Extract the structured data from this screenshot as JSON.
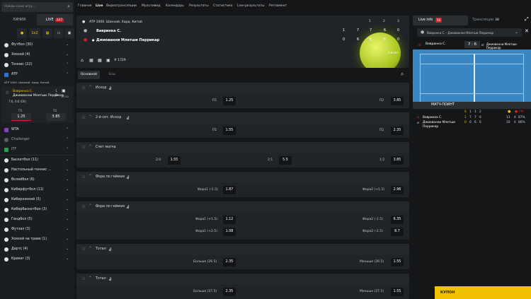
{
  "search": {
    "placeholder": "Найди свою игру..."
  },
  "mode_tabs": {
    "line": "ЛИНИЯ",
    "live": "LIVE",
    "live_count": "127"
  },
  "quick_icons": [
    "1x2"
  ],
  "sidebar": {
    "sports": [
      {
        "label": "Футбол (30)"
      },
      {
        "label": "Хоккей (4)"
      },
      {
        "label": "Теннис (22)"
      },
      {
        "label": "ATP"
      }
    ],
    "match": {
      "tour": "ATP 1000. Шанхай. Хард. Китай",
      "p1": "Вавринка С.",
      "p2": "Джиованни Млетши Перрикар",
      "s1": "1",
      "s2": "0",
      "score": "7:6, 6:6 (00)",
      "time": "15:10",
      "o1_label": "П1",
      "o2_label": "П2",
      "o1": "1.25",
      "o2": "3.85"
    },
    "more": [
      {
        "label": "WTA"
      },
      {
        "label": "Challenger"
      },
      {
        "label": "ITF"
      },
      {
        "label": "Баскетбол (11)"
      },
      {
        "label": "Настольный теннис ..."
      },
      {
        "label": "Волейбол (6)"
      },
      {
        "label": "Киберфутбол (11)"
      },
      {
        "label": "Киберхоккей (5)"
      },
      {
        "label": "Кибербаскетбол (3)"
      },
      {
        "label": "Гандбол (5)"
      },
      {
        "label": "Футзал (3)"
      },
      {
        "label": "Хоккей на траве (1)"
      },
      {
        "label": "Дартс (4)"
      },
      {
        "label": "Крикет (3)"
      }
    ]
  },
  "topnav": [
    "Главная",
    "Live",
    "Видеотрансляции",
    "Мультивид",
    "Календарь",
    "Результаты",
    "Статистика",
    "Live-результаты",
    "Регламент"
  ],
  "header": {
    "tour": "ATP 1000. Шанхай. Хард. Китай",
    "cols": [
      "1",
      "2",
      "3"
    ],
    "p1": "Вавринка С.",
    "p2": "Джиованни Млетши Перрикар",
    "p1_scores": [
      "1",
      "7",
      "7",
      "6",
      "0"
    ],
    "p2_scores": [
      "0",
      "6",
      "6",
      "6",
      "0"
    ],
    "set": "2-й сет",
    "event_id": "# 1729"
  },
  "tabs": {
    "main": "Основной",
    "stats": "Бзы"
  },
  "markets": [
    {
      "title": "Исход",
      "rows": [
        [
          {
            "l": "П1",
            "o": "1.25"
          },
          {
            "l": "П2",
            "o": "3.85"
          }
        ]
      ]
    },
    {
      "title": "2-й сет. Исход",
      "rows": [
        [
          {
            "l": "П1",
            "o": "1.55"
          },
          {
            "l": "П2",
            "o": "2.35"
          }
        ]
      ]
    },
    {
      "title": "Счет матча",
      "rows": [
        [
          {
            "l": "2:0",
            "o": "1.55"
          },
          {
            "l": "2:1",
            "o": "5.5"
          },
          {
            "l": "1:2",
            "o": "3.85"
          }
        ]
      ]
    },
    {
      "title": "Фора по геймам",
      "rows": [
        [
          {
            "l": "Фора1 (-1.5)",
            "o": "1.87"
          },
          {
            "l": "Фора2 (+1.5)",
            "o": "2.96"
          }
        ]
      ]
    },
    {
      "title": "Фора по геймам",
      "rows": [
        [
          {
            "l": "Фора1 (+1.5)",
            "o": "1.12"
          },
          {
            "l": "Фора2 (-1.5)",
            "o": "6.35"
          }
        ],
        [
          {
            "l": "Фора1 (+2.5)",
            "o": "1.08"
          },
          {
            "l": "Фора2 (-2.5)",
            "o": "8.7"
          }
        ]
      ]
    },
    {
      "title": "Тотал",
      "rows": [
        [
          {
            "l": "Больше (26.5)",
            "o": "2.35"
          },
          {
            "l": "Меньше (26.5)",
            "o": "1.55"
          }
        ]
      ]
    },
    {
      "title": "Тотал",
      "rows": [
        [
          {
            "l": "Больше (27.5)",
            "o": "2.35"
          },
          {
            "l": "Меньше (27.5)",
            "o": "1.55"
          }
        ]
      ]
    }
  ],
  "right": {
    "live_info": "Live info",
    "live_info_badge": "50",
    "broadcast": "Трансляции",
    "broadcast_count": "38",
    "match_select": "Вавринка С. - Джиованни Млетши Перрикар",
    "p1": "Вавринка С.",
    "p2": "Джиованни Млетши Перрикар",
    "game_score": "7 : 6",
    "match_point": "МАТЧ-ПОИНТ",
    "sets_head": [
      "S",
      "1",
      "1",
      "2"
    ],
    "p1_row": [
      "1",
      "7",
      "7",
      "6"
    ],
    "p2_row": [
      "0",
      "6",
      "6",
      "6"
    ],
    "stat_head": [
      "",
      "FM"
    ],
    "p1_stat": [
      "13",
      "4",
      "87%"
    ],
    "p2_stat": [
      "10",
      "4",
      "86%"
    ],
    "coupon": "КУПОН"
  }
}
